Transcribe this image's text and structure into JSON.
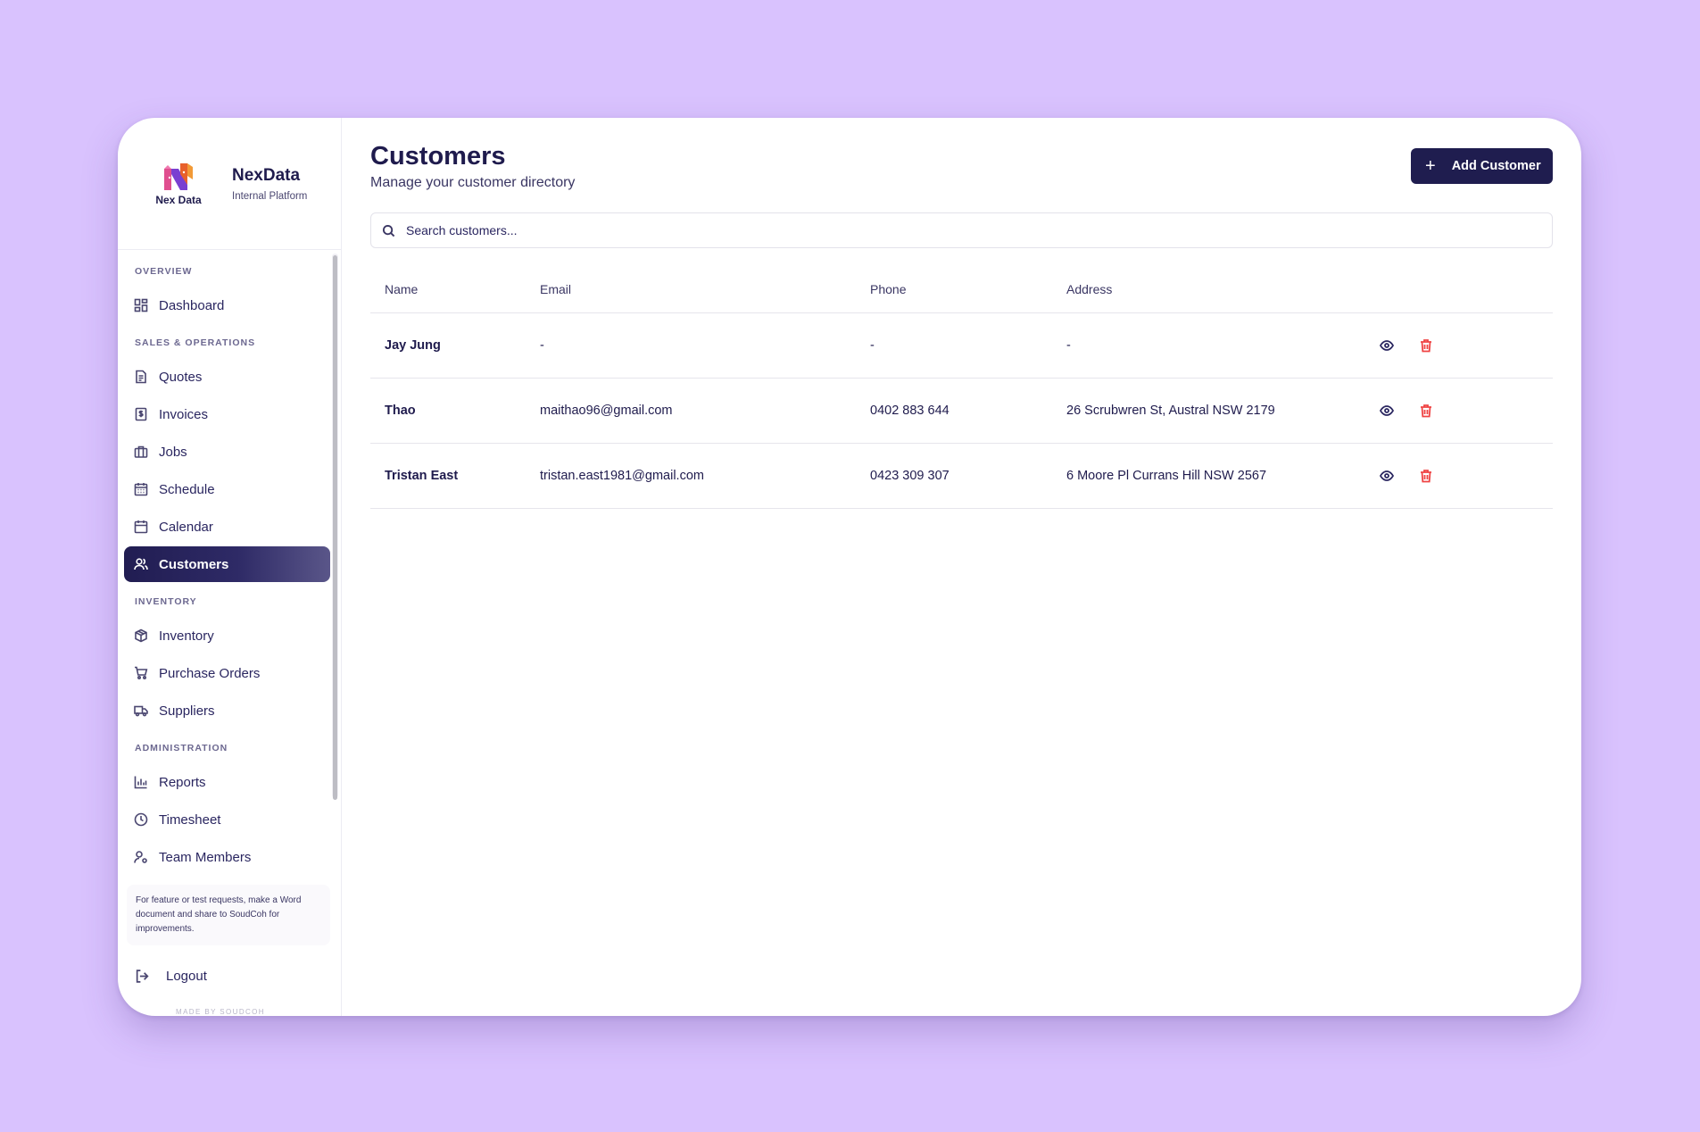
{
  "brand": {
    "logo_text": "Nex Data",
    "name": "NexData",
    "subtitle": "Internal Platform"
  },
  "sidebar": {
    "sections": {
      "overview": "OVERVIEW",
      "sales": "SALES & OPERATIONS",
      "inventory": "INVENTORY",
      "admin": "ADMINISTRATION"
    },
    "items": {
      "dashboard": "Dashboard",
      "quotes": "Quotes",
      "invoices": "Invoices",
      "jobs": "Jobs",
      "schedule": "Schedule",
      "calendar": "Calendar",
      "customers": "Customers",
      "inventory": "Inventory",
      "purchase_orders": "Purchase Orders",
      "suppliers": "Suppliers",
      "reports": "Reports",
      "timesheet": "Timesheet",
      "team_members": "Team Members"
    },
    "active": "customers",
    "feature_note": "For feature or test requests, make a Word document and share to SoudCoh for improvements.",
    "logout": "Logout",
    "made_by": "MADE BY SOUDCOH"
  },
  "main": {
    "title": "Customers",
    "subtitle": "Manage your customer directory",
    "add_button": "Add Customer",
    "search_placeholder": "Search customers..."
  },
  "table": {
    "headers": {
      "name": "Name",
      "email": "Email",
      "phone": "Phone",
      "address": "Address"
    },
    "rows": [
      {
        "name": "Jay Jung",
        "email": "-",
        "phone": "-",
        "address": "-"
      },
      {
        "name": "Thao",
        "email": "maithao96@gmail.com",
        "phone": "0402 883 644",
        "address": "26 Scrubwren St, Austral NSW 2179"
      },
      {
        "name": "Tristan East",
        "email": "tristan.east1981@gmail.com",
        "phone": "0423 309 307",
        "address": "6 Moore Pl Currans Hill NSW 2567"
      }
    ]
  },
  "colors": {
    "background": "#d9c2fe",
    "primary": "#1f1d4f",
    "delete": "#ef4444"
  }
}
